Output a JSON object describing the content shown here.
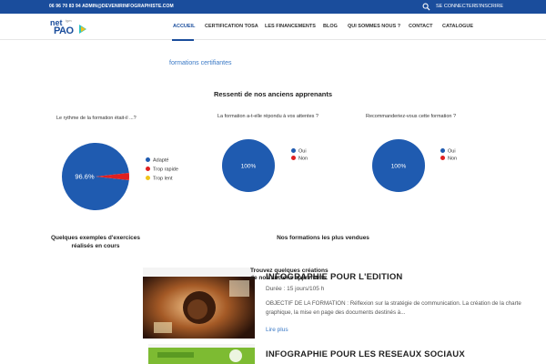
{
  "topbar": {
    "contact": "06 96 70 83 94 ADMIN@DEVENIRINFOGRAPHISTE.COM",
    "search_icon": "search-icon",
    "connect": "SE CONNECTER",
    "signup": "S'INSCRIRE"
  },
  "logo": {
    "net": "net",
    "pao": "PAO",
    "tiny": "tgvn"
  },
  "nav": [
    {
      "label": "ACCUEIL"
    },
    {
      "label": "CERTIFICATION TOSA"
    },
    {
      "label": "LES FINANCEMENTS"
    },
    {
      "label": "BLOG"
    },
    {
      "label": "QUI SOMMES NOUS ?"
    },
    {
      "label": "CONTACT"
    },
    {
      "label": "CATALOGUE"
    }
  ],
  "link_formations": "formations certifiantes",
  "survey": {
    "title": "Ressenti de nos anciens apprenants",
    "questions": [
      "Le rythme de la formation était-il ...?",
      "La formation a-t-elle répondu à vos attentes ?",
      "Recommanderiez-vous cette formation ?"
    ]
  },
  "colors": {
    "blue": "#1a4d9c",
    "red": "#e02020",
    "yellow": "#f0c419",
    "pie_blue": "#1f5bb0"
  },
  "chart_data": [
    {
      "type": "pie",
      "title": "Le rythme de la formation était-il ...?",
      "categories": [
        "Adapté",
        "Trop rapide",
        "Trop lent"
      ],
      "values": [
        96.6,
        3.4,
        0
      ],
      "colors": [
        "#1f5bb0",
        "#e02020",
        "#f0c419"
      ],
      "center_label": "96.6%"
    },
    {
      "type": "pie",
      "title": "La formation a-t-elle répondu à vos attentes ?",
      "categories": [
        "Oui",
        "Non"
      ],
      "values": [
        100,
        0
      ],
      "colors": [
        "#1f5bb0",
        "#e02020"
      ],
      "center_label": "100%"
    },
    {
      "type": "pie",
      "title": "Recommanderiez-vous cette formation ?",
      "categories": [
        "Oui",
        "Non"
      ],
      "values": [
        100,
        0
      ],
      "colors": [
        "#1f5bb0",
        "#e02020"
      ],
      "center_label": "100%"
    }
  ],
  "examples_heading": "Quelques exemples d'exercices réalisés en cours",
  "bestsellers_heading": "Nos formations les plus vendues",
  "slider_title": "Trouvez quelques créations de nos anciens apprenants",
  "courses": [
    {
      "title": "INFOGRAPHIE POUR L'EDITION",
      "duration": "Durée : 15 jours/105 h",
      "desc": "OBJECTIF DE LA FORMATION : Réflexion sur la stratégie de communication. La création de la charte graphique, la mise en page des documents destinés à...",
      "more": "Lire plus"
    },
    {
      "title": "INFOGRAPHIE POUR LES RESEAUX SOCIAUX"
    }
  ]
}
